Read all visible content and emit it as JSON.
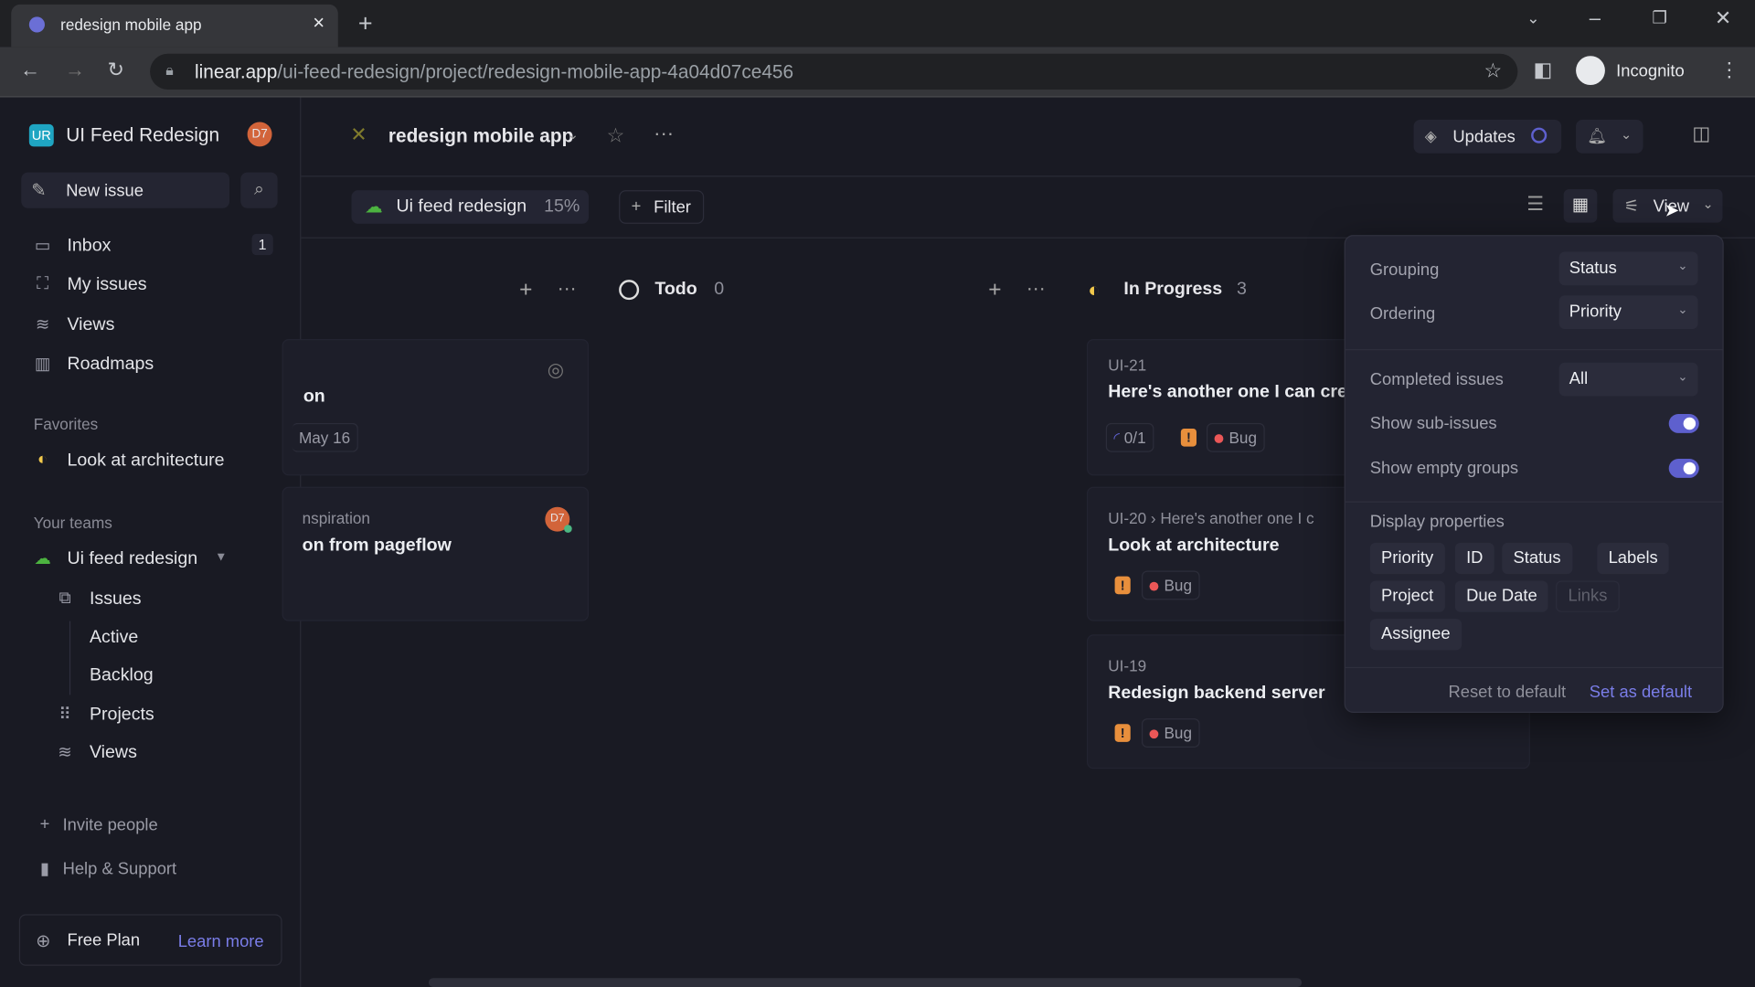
{
  "browser": {
    "tab_title": "redesign mobile app",
    "url_host": "linear.app",
    "url_path": "/ui-feed-redesign/project/redesign-mobile-app-4a04d07ce456",
    "profile": "Incognito"
  },
  "workspace": {
    "initials": "UR",
    "name": "UI Feed Redesign",
    "avatar": "D7"
  },
  "sidebar": {
    "new_issue": "New issue",
    "nav": [
      {
        "label": "Inbox",
        "badge": "1"
      },
      {
        "label": "My issues"
      },
      {
        "label": "Views"
      },
      {
        "label": "Roadmaps"
      }
    ],
    "favorites_heading": "Favorites",
    "favorites": [
      "Look at architecture"
    ],
    "teams_heading": "Your teams",
    "team": "Ui feed redesign",
    "team_items": [
      "Issues",
      "Active",
      "Backlog",
      "Projects",
      "Views"
    ],
    "invite": "Invite people",
    "help": "Help & Support",
    "plan": "Free Plan",
    "learn_more": "Learn more"
  },
  "header": {
    "project": "redesign mobile app",
    "updates": "Updates"
  },
  "toolbar": {
    "team_pill": "Ui feed redesign",
    "progress": "15%",
    "filter": "Filter",
    "view": "View"
  },
  "columns": [
    {
      "name": "",
      "cards": [
        {
          "title": "on",
          "date": "May 16"
        },
        {
          "id": "nspiration",
          "title": "on from pageflow",
          "avatar": "D7"
        }
      ]
    },
    {
      "name": "Todo",
      "count": "0"
    },
    {
      "name": "In Progress",
      "count": "3",
      "cards": [
        {
          "id": "UI-21",
          "title": "Here's another one I can cre",
          "sub": "0/1",
          "label": "Bug"
        },
        {
          "id": "UI-20",
          "parent": "Here's another one I c",
          "title": "Look at architecture",
          "label": "Bug"
        },
        {
          "id": "UI-19",
          "title": "Redesign backend server",
          "label": "Bug"
        }
      ]
    }
  ],
  "view_panel": {
    "grouping_label": "Grouping",
    "grouping": "Status",
    "ordering_label": "Ordering",
    "ordering": "Priority",
    "completed_label": "Completed issues",
    "completed": "All",
    "sub_issues_label": "Show sub-issues",
    "sub_issues": true,
    "empty_groups_label": "Show empty groups",
    "empty_groups": true,
    "display_label": "Display properties",
    "properties": [
      {
        "label": "Priority",
        "on": true
      },
      {
        "label": "ID",
        "on": true
      },
      {
        "label": "Status",
        "on": true
      },
      {
        "label": "Labels",
        "on": true
      },
      {
        "label": "Project",
        "on": true
      },
      {
        "label": "Due Date",
        "on": true
      },
      {
        "label": "Links",
        "on": false
      },
      {
        "label": "Assignee",
        "on": true
      }
    ],
    "reset": "Reset to default",
    "set_default": "Set as default"
  },
  "colors": {
    "accent": "#5e60ce",
    "in_progress": "#f2c94c",
    "bug": "#eb5757",
    "priority": "#e88f3c"
  }
}
